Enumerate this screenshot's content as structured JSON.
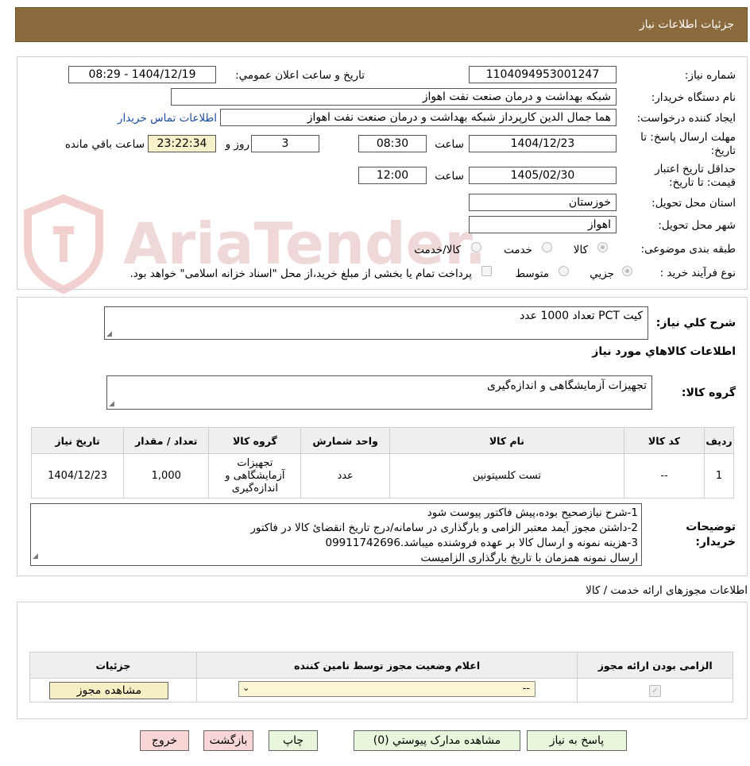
{
  "header": {
    "title": "جزئيات اطلاعات نياز"
  },
  "form": {
    "need_number_label": "شماره نياز:",
    "need_number": "1104094953001247",
    "announce_label": "تاريخ و ساعت اعلان عمومي:",
    "announce_value": "1404/12/19 - 08:29",
    "buyer_org_label": "نام دستگاه خريدار:",
    "buyer_org": "شبکه بهداشت و درمان صنعت نفت اهواز",
    "requester_label": "ايجاد کننده درخواست:",
    "requester": "هما جمال الدين کارپرداز شبکه بهداشت و درمان صنعت نفت اهواز",
    "contact_link": "اطلاعات تماس خريدار",
    "deadline_label": "مهلت ارسال پاسخ: تا تاريخ:",
    "deadline_date": "1404/12/23",
    "time_label": "ساعت",
    "deadline_time": "08:30",
    "days_value": "3",
    "days_label": "روز و",
    "remaining_time": "23:22:34",
    "remaining_label": "ساعت باقي مانده",
    "validity_label": "حداقل تاريخ اعتبار قيمت: تا تاريخ:",
    "validity_date": "1405/02/30",
    "validity_time": "12:00",
    "province_label": "استان محل تحويل:",
    "province": "خوزستان",
    "city_label": "شهر محل تحويل:",
    "city": "اهواز",
    "category_label": "طبقه بندی موضوعی:",
    "category_options": [
      "کالا",
      "خدمت",
      "کالا/خدمت"
    ],
    "process_label": "نوع فرآيند خريد :",
    "process_options": [
      "جزيي",
      "متوسط"
    ],
    "process_note": "پرداخت تمام يا بخشی از مبلغ خريد،از محل \"اسناد خزانه اسلامی\" خواهد بود."
  },
  "summary": {
    "label": "شرح كلي نياز:",
    "text": "کیت PCT تعداد 1000 عدد"
  },
  "goods": {
    "section_title": "اطلاعات كالاهاي مورد نياز",
    "group_label": "گروه كالا:",
    "group_value": "تجهیزات آزمایشگاهی و اندازه‌گیری",
    "table_headers": [
      "رديف",
      "کد کالا",
      "نام کالا",
      "واحد شمارش",
      "گروه کالا",
      "تعداد / مقدار",
      "تاريخ نياز"
    ],
    "rows": [
      {
        "row": "1",
        "code": "--",
        "name": "تست کلسیتونین",
        "unit": "عدد",
        "group": "تجهيزات آزمايشگاهی و اندازه‌گيری",
        "qty": "1,000",
        "date": "1404/12/23"
      }
    ]
  },
  "buyer_notes": {
    "label": "توضيحات خريدار:",
    "lines": [
      "1-شرح نیازصحیح بوده،پیش فاکتور  پیوست شود",
      "2-داشتن مجوز آیمد معتبر الزامی و بارگذاری در سامانه/درج تاریخ انقضائ کالا در فاکتور",
      "3-هزینه نمونه و ارسال کالا بر عهده فروشنده میباشد.09911742696",
      "ارسال نمونه همزمان با تاریخ بارگذاری الزامیست"
    ]
  },
  "permits": {
    "title": "اطلاعات مجوزهای ارائه خدمت / کالا",
    "headers": [
      "الزامی بودن ارائه مجوز",
      "اعلام وضعيت مجوز توسط نامين کننده",
      "جزئيات"
    ],
    "select_value": "--",
    "view_button": "مشاهده مجوز"
  },
  "actions": {
    "reply": "پاسخ به نياز",
    "attachments": "مشاهده مدارک پيوستي (0)",
    "print": "چاپ",
    "back": "بازگشت",
    "exit": "خروج"
  },
  "watermark": {
    "text": "AriaTender.neT"
  },
  "colors": {
    "header": "#8b6a3e",
    "link": "#1a4fa0",
    "green_btn": "#e8f7dc",
    "pink_btn": "#f9d6d6",
    "remaining_bg": "#f6f1c8"
  }
}
